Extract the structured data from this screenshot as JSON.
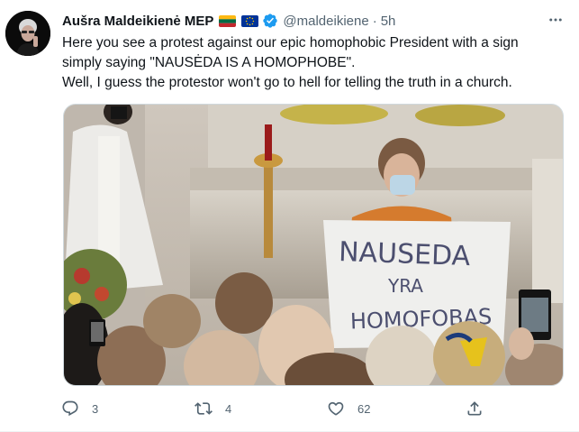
{
  "user": {
    "display_name": "Aušra Maldeikienė MEP",
    "handle": "@maldeikiene",
    "separator": "·",
    "time": "5h",
    "flags": [
      "lithuania-flag",
      "eu-flag"
    ],
    "verified_icon": "verified-badge-icon"
  },
  "tweet": {
    "line1": "Here you see a protest against our epic homophobic President with a sign",
    "line2": "simply saying \"NAUSĖDA IS A HOMOPHOBE\".",
    "line3": "Well, I guess the protestor won't go to hell for telling the truth in a church."
  },
  "image": {
    "sign_line1": "NAUSEDA",
    "sign_line2": "YRA",
    "sign_line3": "HOMOFOBAS"
  },
  "actions": {
    "reply_count": "3",
    "retweet_count": "4",
    "like_count": "62"
  },
  "icons": {
    "more": "more-dots-icon",
    "reply": "reply-icon",
    "retweet": "retweet-icon",
    "like": "heart-icon",
    "share": "share-icon"
  },
  "colors": {
    "verified": "#1d9bf0",
    "secondary_text": "#536471"
  }
}
